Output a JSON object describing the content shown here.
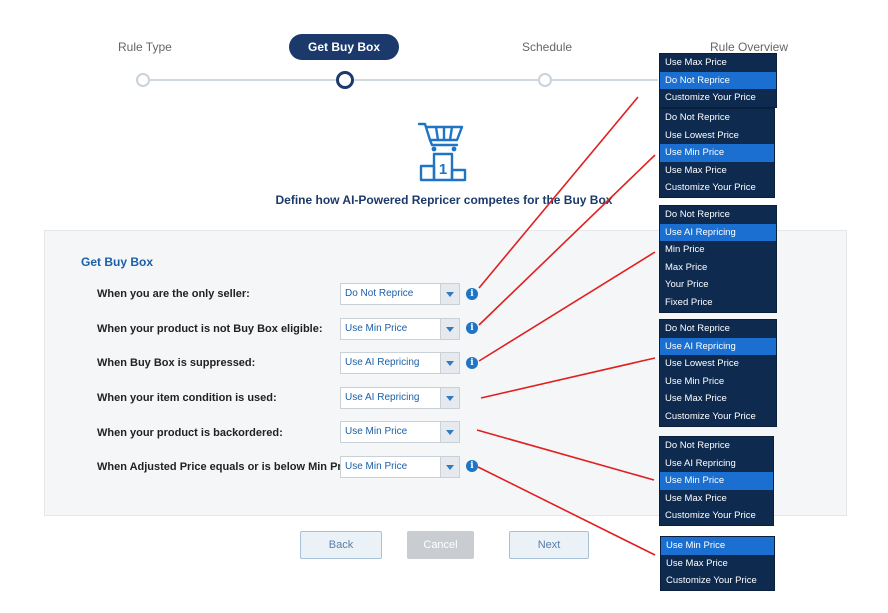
{
  "stepper": {
    "steps": [
      "Rule Type",
      "Get Buy Box",
      "Schedule",
      "Rule Overview"
    ],
    "active_step": "Get Buy Box"
  },
  "subtitle": "Define how AI-Powered Repricer competes for the Buy Box",
  "panel": {
    "title": "Get Buy Box",
    "rows": [
      {
        "label": "When you are the only seller:",
        "value": "Do Not Reprice"
      },
      {
        "label": "When your product is not Buy Box eligible:",
        "value": "Use Min Price"
      },
      {
        "label": "When Buy Box is suppressed:",
        "value": "Use AI Repricing"
      },
      {
        "label": "When your item condition is used:",
        "value": "Use AI Repricing"
      },
      {
        "label": "When your product is backordered:",
        "value": "Use Min Price"
      },
      {
        "label": "When Adjusted Price equals or is below Min Price:",
        "value": "Use Min Price"
      }
    ]
  },
  "buttons": {
    "back": "Back",
    "cancel": "Cancel",
    "next": "Next"
  },
  "dropdowns": [
    {
      "items": [
        "Use Max Price",
        "Do Not Reprice",
        "Customize Your Price"
      ],
      "selected": "Do Not Reprice"
    },
    {
      "items": [
        "Do Not Reprice",
        "Use Lowest Price",
        "Use Min Price",
        "Use Max Price",
        "Customize Your Price"
      ],
      "selected": "Use Min Price"
    },
    {
      "items": [
        "Do Not Reprice",
        "Use AI Repricing",
        "Min Price",
        "Max Price",
        "Your Price",
        "Fixed Price"
      ],
      "selected": "Use AI Repricing"
    },
    {
      "items": [
        "Do Not Reprice",
        "Use AI Repricing",
        "Use Lowest Price",
        "Use Min Price",
        "Use Max Price",
        "Customize Your Price"
      ],
      "selected": "Use AI Repricing"
    },
    {
      "items": [
        "Do Not Reprice",
        "Use AI Repricing",
        "Use Min Price",
        "Use Max Price",
        "Customize Your Price"
      ],
      "selected": "Use Min Price"
    },
    {
      "items": [
        "Use Min Price",
        "Use Max Price",
        "Customize Your Price"
      ],
      "selected": "Use Min Price"
    }
  ],
  "colors": {
    "navy": "#1b3a6b",
    "accent": "#1f74c4",
    "dropdown_bg": "#0e2a4f",
    "dropdown_selected": "#1a6fd0",
    "callout_line": "#e02020"
  }
}
